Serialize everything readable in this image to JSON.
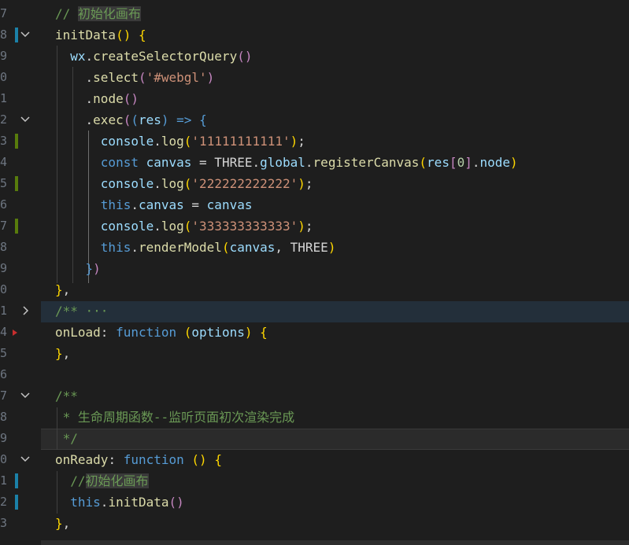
{
  "editor": {
    "lines": [
      {
        "ln": "7",
        "segs": [
          [
            "c",
            "// "
          ],
          [
            "c hlword",
            "初始化画布"
          ]
        ]
      },
      {
        "ln": "8",
        "segs": [
          [
            "f",
            "initData"
          ],
          [
            "y",
            "()"
          ],
          [
            "w",
            " "
          ],
          [
            "y",
            "{"
          ]
        ]
      },
      {
        "ln": "9",
        "segs": [
          [
            "w",
            "  "
          ],
          [
            "v",
            "wx"
          ],
          [
            "w",
            "."
          ],
          [
            "f",
            "createSelectorQuery"
          ],
          [
            "p",
            "()"
          ]
        ]
      },
      {
        "ln": "0",
        "segs": [
          [
            "w",
            "    ."
          ],
          [
            "f",
            "select"
          ],
          [
            "p",
            "("
          ],
          [
            "s",
            "'#webgl'"
          ],
          [
            "p",
            ")"
          ]
        ]
      },
      {
        "ln": "1",
        "segs": [
          [
            "w",
            "    ."
          ],
          [
            "f",
            "node"
          ],
          [
            "p",
            "()"
          ]
        ]
      },
      {
        "ln": "2",
        "segs": [
          [
            "w",
            "    ."
          ],
          [
            "f",
            "exec"
          ],
          [
            "p",
            "("
          ],
          [
            "k",
            "("
          ],
          [
            "v",
            "res"
          ],
          [
            "k",
            ")"
          ],
          [
            "w",
            " "
          ],
          [
            "k",
            "=>"
          ],
          [
            "w",
            " "
          ],
          [
            "k",
            "{"
          ]
        ]
      },
      {
        "ln": "3",
        "segs": [
          [
            "w",
            "      "
          ],
          [
            "v",
            "console"
          ],
          [
            "w",
            "."
          ],
          [
            "f",
            "log"
          ],
          [
            "y",
            "("
          ],
          [
            "s",
            "'11111111111'"
          ],
          [
            "y",
            ")"
          ],
          [
            "w",
            ";"
          ]
        ]
      },
      {
        "ln": "4",
        "segs": [
          [
            "w",
            "      "
          ],
          [
            "k",
            "const"
          ],
          [
            "w",
            " "
          ],
          [
            "v",
            "canvas"
          ],
          [
            "w",
            " = THREE."
          ],
          [
            "v",
            "global"
          ],
          [
            "w",
            "."
          ],
          [
            "f",
            "registerCanvas"
          ],
          [
            "y",
            "("
          ],
          [
            "v",
            "res"
          ],
          [
            "p",
            "["
          ],
          [
            "n",
            "0"
          ],
          [
            "p",
            "]"
          ],
          [
            "w",
            "."
          ],
          [
            "v",
            "node"
          ],
          [
            "y",
            ")"
          ]
        ]
      },
      {
        "ln": "5",
        "segs": [
          [
            "w",
            "      "
          ],
          [
            "v",
            "console"
          ],
          [
            "w",
            "."
          ],
          [
            "f",
            "log"
          ],
          [
            "y",
            "("
          ],
          [
            "s",
            "'222222222222'"
          ],
          [
            "y",
            ")"
          ],
          [
            "w",
            ";"
          ]
        ]
      },
      {
        "ln": "6",
        "segs": [
          [
            "w",
            "      "
          ],
          [
            "k",
            "this"
          ],
          [
            "w",
            "."
          ],
          [
            "v",
            "canvas"
          ],
          [
            "w",
            " = "
          ],
          [
            "v",
            "canvas"
          ]
        ]
      },
      {
        "ln": "7",
        "segs": [
          [
            "w",
            "      "
          ],
          [
            "v",
            "console"
          ],
          [
            "w",
            "."
          ],
          [
            "f",
            "log"
          ],
          [
            "y",
            "("
          ],
          [
            "s",
            "'333333333333'"
          ],
          [
            "y",
            ")"
          ],
          [
            "w",
            ";"
          ]
        ]
      },
      {
        "ln": "8",
        "segs": [
          [
            "w",
            "      "
          ],
          [
            "k",
            "this"
          ],
          [
            "w",
            "."
          ],
          [
            "f",
            "renderModel"
          ],
          [
            "y",
            "("
          ],
          [
            "v",
            "canvas"
          ],
          [
            "w",
            ", THREE"
          ],
          [
            "y",
            ")"
          ]
        ]
      },
      {
        "ln": "9",
        "segs": [
          [
            "w",
            "    "
          ],
          [
            "k",
            "}"
          ],
          [
            "p",
            ")"
          ]
        ]
      },
      {
        "ln": "0",
        "segs": [
          [
            "y",
            "}"
          ],
          [
            "w",
            ","
          ]
        ]
      },
      {
        "ln": "1",
        "segs": [
          [
            "c",
            "/** "
          ],
          [
            "c",
            "···"
          ]
        ]
      },
      {
        "ln": "4",
        "segs": [
          [
            "f",
            "onLoad"
          ],
          [
            "w",
            ": "
          ],
          [
            "k",
            "function"
          ],
          [
            "w",
            " "
          ],
          [
            "y",
            "("
          ],
          [
            "v",
            "options"
          ],
          [
            "y",
            ")"
          ],
          [
            "w",
            " "
          ],
          [
            "y",
            "{"
          ]
        ]
      },
      {
        "ln": "5",
        "segs": [
          [
            "y",
            "}"
          ],
          [
            "w",
            ","
          ]
        ]
      },
      {
        "ln": "6",
        "segs": [
          [
            "w",
            ""
          ]
        ]
      },
      {
        "ln": "7",
        "segs": [
          [
            "c",
            "/**"
          ]
        ]
      },
      {
        "ln": "8",
        "segs": [
          [
            "c",
            " * 生命周期函数--监听页面初次渲染完成"
          ]
        ]
      },
      {
        "ln": "9",
        "segs": [
          [
            "c",
            " */"
          ]
        ]
      },
      {
        "ln": "0",
        "segs": [
          [
            "f",
            "onReady"
          ],
          [
            "w",
            ": "
          ],
          [
            "k",
            "function"
          ],
          [
            "w",
            " "
          ],
          [
            "y",
            "()"
          ],
          [
            "w",
            " "
          ],
          [
            "y",
            "{"
          ]
        ]
      },
      {
        "ln": "1",
        "segs": [
          [
            "w",
            "  "
          ],
          [
            "c",
            "//"
          ],
          [
            "c hlword",
            "初始化画布"
          ]
        ]
      },
      {
        "ln": "2",
        "segs": [
          [
            "w",
            "  "
          ],
          [
            "k",
            "this"
          ],
          [
            "w",
            "."
          ],
          [
            "f",
            "initData"
          ],
          [
            "p",
            "()"
          ]
        ]
      },
      {
        "ln": "3",
        "segs": [
          [
            "y",
            "}"
          ],
          [
            "w",
            ","
          ]
        ]
      }
    ]
  },
  "gutter_marks": [
    {
      "line": 1,
      "fold": "chevron-down",
      "git": "mod"
    },
    {
      "line": 5,
      "fold": "chevron-down"
    },
    {
      "line": 6,
      "git": "add"
    },
    {
      "line": 8,
      "git": "add"
    },
    {
      "line": 10,
      "git": "add"
    },
    {
      "line": 14,
      "fold": "chevron-right"
    },
    {
      "line": 15,
      "breakpoint": true
    },
    {
      "line": 18,
      "fold": "chevron-down"
    },
    {
      "line": 21,
      "fold": "chevron-down"
    },
    {
      "line": 22,
      "git": "mod"
    },
    {
      "line": 23,
      "git": "mod"
    }
  ]
}
